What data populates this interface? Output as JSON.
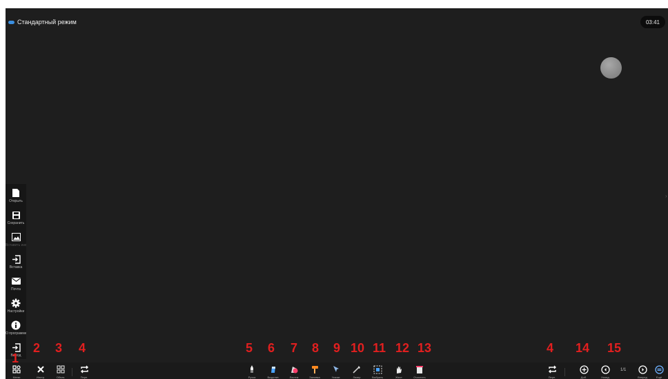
{
  "header": {
    "mode_label": "Стандартный режим",
    "clock": "03:41"
  },
  "side_menu": [
    {
      "label": "Открыть",
      "icon": "file-icon"
    },
    {
      "label": "Сохранить",
      "icon": "save-icon"
    },
    {
      "label": "Вставить изображение",
      "icon": "image-icon"
    },
    {
      "label": "Вставка",
      "icon": "import-icon"
    },
    {
      "label": "Почта",
      "icon": "mail-icon"
    },
    {
      "label": "Настройки",
      "icon": "gear-icon"
    },
    {
      "label": "О программе",
      "icon": "info-icon"
    },
    {
      "label": "Выход",
      "icon": "exit-icon"
    }
  ],
  "left_tools": {
    "menu": "Меню",
    "tools": "Инстр.",
    "objects": "Объек.",
    "switch": "Пере."
  },
  "center_tools": {
    "pen": "Ручка",
    "marker": "Выделит.",
    "eraser": "Ластик",
    "fill": "Заливка",
    "pointer": "Указат.",
    "laser": "Лазер",
    "select": "Выбрать",
    "gesture": "Жест",
    "clear": "Очистить"
  },
  "right_tools": {
    "switch": "Пере.",
    "add": "Доб.",
    "prev": "Назад",
    "page_count": "1/1",
    "next": "Вперед",
    "more": "Ещё"
  },
  "annotations": [
    "1",
    "2",
    "3",
    "4",
    "5",
    "6",
    "7",
    "8",
    "9",
    "10",
    "11",
    "12",
    "13",
    "4",
    "14",
    "15"
  ],
  "colors": {
    "background": "#1e1e1e",
    "accent": "#3b8fe0",
    "annotation": "#e21f1f"
  }
}
